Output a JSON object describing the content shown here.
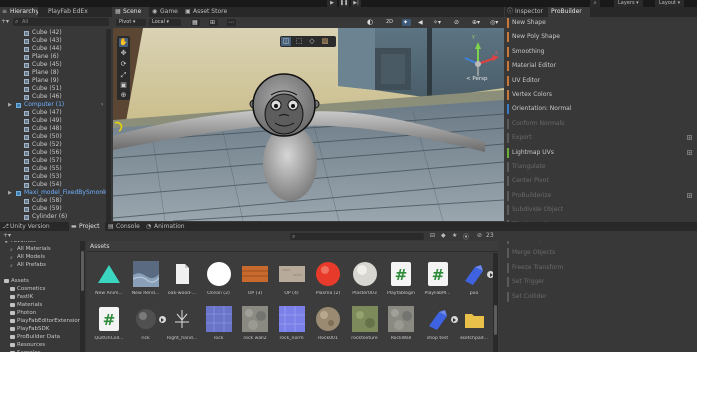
{
  "toolbar": {
    "play_icon": "play-icon",
    "pause_icon": "pause-icon",
    "step_icon": "step-icon",
    "layers_label": "Layers",
    "layout_label": "Layout"
  },
  "tabs": {
    "hierarchy": "Hierarchy",
    "playfab": "PlayFab EdEx",
    "scene": "Scene",
    "game": "Game",
    "asset_store": "Asset Store",
    "inspector": "Inspector",
    "probuilder": "ProBuilder",
    "version_control": "Unity Version Control",
    "project": "Project",
    "console": "Console",
    "animation": "Animation"
  },
  "hierarchy": {
    "search_prefix": "All",
    "items": [
      {
        "label": "Cube (42)",
        "blue": false
      },
      {
        "label": "Cube (43)",
        "blue": false
      },
      {
        "label": "Cube (44)",
        "blue": false
      },
      {
        "label": "Plane (6)",
        "blue": false
      },
      {
        "label": "Cube (45)",
        "blue": false
      },
      {
        "label": "Plane (8)",
        "blue": false
      },
      {
        "label": "Plane (9)",
        "blue": false
      },
      {
        "label": "Cube (51)",
        "blue": false
      },
      {
        "label": "Cube (46)",
        "blue": false
      },
      {
        "label": "Computer (1)",
        "blue": true
      },
      {
        "label": "Cube (47)",
        "blue": false
      },
      {
        "label": "Cube (49)",
        "blue": false
      },
      {
        "label": "Cube (48)",
        "blue": false
      },
      {
        "label": "Cube (50)",
        "blue": false
      },
      {
        "label": "Cube (52)",
        "blue": false
      },
      {
        "label": "Cube (56)",
        "blue": false
      },
      {
        "label": "Cube (57)",
        "blue": false
      },
      {
        "label": "Cube (55)",
        "blue": false
      },
      {
        "label": "Cube (53)",
        "blue": false
      },
      {
        "label": "Cube (54)",
        "blue": false
      },
      {
        "label": "Maxi_model_FixedBySmonk1",
        "blue": true
      },
      {
        "label": "Cube (58)",
        "blue": false
      },
      {
        "label": "Cube (59)",
        "blue": false
      },
      {
        "label": "Cylinder (6)",
        "blue": false
      }
    ]
  },
  "scene": {
    "pivot": "Pivot",
    "local": "Local",
    "mode_2d": "2D",
    "persp": "< Persp",
    "gizmo_y": "y",
    "gizmo_x": "x"
  },
  "probuilder": {
    "items": [
      {
        "label": "New Shape",
        "color": "#c87a3c",
        "disabled": false,
        "plus": false
      },
      {
        "label": "New Poly Shape",
        "color": "#c87a3c",
        "disabled": false,
        "plus": false
      },
      {
        "label": "Smoothing",
        "color": "#c87a3c",
        "disabled": false,
        "plus": false
      },
      {
        "label": "Material Editor",
        "color": "#c87a3c",
        "disabled": false,
        "plus": false
      },
      {
        "label": "UV Editor",
        "color": "#c87a3c",
        "disabled": false,
        "plus": false
      },
      {
        "label": "Vertex Colors",
        "color": "#c87a3c",
        "disabled": false,
        "plus": false
      },
      {
        "label": "Orientation: Normal",
        "color": "#3a7cc8",
        "disabled": false,
        "plus": false
      },
      {
        "label": "Conform Normals",
        "color": "#5a5a5a",
        "disabled": true,
        "plus": false
      },
      {
        "label": "Export",
        "color": "#5a5a5a",
        "disabled": true,
        "plus": true
      },
      {
        "label": "Lightmap UVs",
        "color": "#6cae3c",
        "disabled": false,
        "plus": true
      },
      {
        "label": "Triangulate",
        "color": "#5a5a5a",
        "disabled": true,
        "plus": false
      },
      {
        "label": "Center Pivot",
        "color": "#5a5a5a",
        "disabled": true,
        "plus": false
      },
      {
        "label": "ProBuilderize",
        "color": "#5a5a5a",
        "disabled": true,
        "plus": true
      },
      {
        "label": "Subdivide Object",
        "color": "#5a5a5a",
        "disabled": true,
        "plus": false
      },
      {
        "label": "Flip Normals",
        "color": "#5a5a5a",
        "disabled": true,
        "plus": false
      },
      {
        "label": "Mirror Objects",
        "color": "#5a5a5a",
        "disabled": true,
        "plus": true
      },
      {
        "label": "Merge Objects",
        "color": "#5a5a5a",
        "disabled": true,
        "plus": false
      },
      {
        "label": "Freeze Transform",
        "color": "#5a5a5a",
        "disabled": true,
        "plus": false
      },
      {
        "label": "Set Trigger",
        "color": "#5a5a5a",
        "disabled": true,
        "plus": false
      },
      {
        "label": "Set Collider",
        "color": "#5a5a5a",
        "disabled": true,
        "plus": false
      }
    ]
  },
  "project": {
    "count": "23",
    "assets_header": "Assets",
    "folders": [
      {
        "label": "Favorites",
        "indent": 0,
        "type": "star"
      },
      {
        "label": "All Materials",
        "indent": 1,
        "type": "search"
      },
      {
        "label": "All Models",
        "indent": 1,
        "type": "search"
      },
      {
        "label": "All Prefabs",
        "indent": 1,
        "type": "search"
      },
      {
        "label": "",
        "indent": 0,
        "type": "blank"
      },
      {
        "label": "Assets",
        "indent": 0,
        "type": "folder"
      },
      {
        "label": "Cosmetics",
        "indent": 1,
        "type": "folder"
      },
      {
        "label": "FastIK",
        "indent": 1,
        "type": "folder"
      },
      {
        "label": "Materials",
        "indent": 1,
        "type": "folder"
      },
      {
        "label": "Photon",
        "indent": 1,
        "type": "folder"
      },
      {
        "label": "PlayFabEditorExtensions",
        "indent": 1,
        "type": "folder"
      },
      {
        "label": "PlayFabSDK",
        "indent": 1,
        "type": "folder"
      },
      {
        "label": "ProBuilder Data",
        "indent": 1,
        "type": "folder"
      },
      {
        "label": "Resources",
        "indent": 1,
        "type": "folder"
      },
      {
        "label": "Samples",
        "indent": 1,
        "type": "folder"
      }
    ],
    "assets_row1": [
      {
        "label": "New Anim...",
        "kind": "anim"
      },
      {
        "label": "New Rend...",
        "kind": "render"
      },
      {
        "label": "oak-wood-...",
        "kind": "file"
      },
      {
        "label": "Ocean (2)",
        "kind": "white"
      },
      {
        "label": "OP (3)",
        "kind": "wood"
      },
      {
        "label": "OP (4)",
        "kind": "plaster"
      },
      {
        "label": "Plasma (2)",
        "kind": "red"
      },
      {
        "label": "Plaster003",
        "kind": "sphere"
      },
      {
        "label": "Playfablogin",
        "kind": "cs"
      },
      {
        "label": "PlayFabM...",
        "kind": "cs"
      },
      {
        "label": "poo",
        "kind": "blueobj"
      }
    ],
    "assets_row2": [
      {
        "label": "QuitOnColl...",
        "kind": "cs"
      },
      {
        "label": "rick",
        "kind": "darksphere"
      },
      {
        "label": "Right_hand...",
        "kind": "hand"
      },
      {
        "label": "rock",
        "kind": "bluerock"
      },
      {
        "label": "rock wall2",
        "kind": "rockwall"
      },
      {
        "label": "rock_norm",
        "kind": "normal"
      },
      {
        "label": "Rock001",
        "kind": "rocksphere"
      },
      {
        "label": "rocktexture",
        "kind": "mossy"
      },
      {
        "label": "RockWall",
        "kind": "rockwall"
      },
      {
        "label": "shop test",
        "kind": "blueobj"
      },
      {
        "label": "sketchpad...",
        "kind": "folder"
      }
    ]
  }
}
